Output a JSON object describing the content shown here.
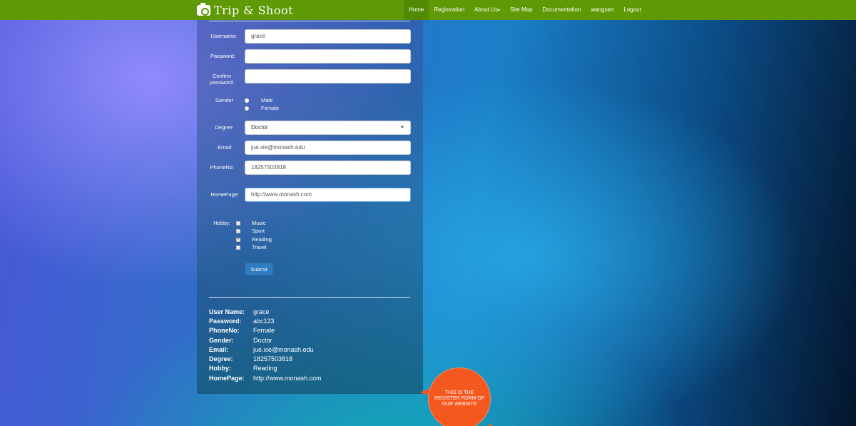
{
  "brand": {
    "name": "Trip & Shoot",
    "icon": "camera-icon"
  },
  "nav": {
    "items": [
      "Home",
      "Registration",
      "About Us",
      "Site Map",
      "Documentation",
      "wangsen",
      "Logout"
    ],
    "active": "Home"
  },
  "form": {
    "username_label": "Username:",
    "username_value": "grace",
    "password_label": "Password:",
    "confirm_label_1": "Confirm",
    "confirm_label_2": "password:",
    "gender_label": "Gender",
    "gender_options": [
      "Male",
      "Female"
    ],
    "gender_selected": "Male",
    "degree_label": "Degree",
    "degree_value": "Doctor",
    "email_label": "Email:",
    "email_value": "jue.xie@monash.edu",
    "phone_label": "PhoneNo:",
    "phone_value": "18257503818",
    "homepage_label": "HomePage:",
    "homepage_value": "http://www.monash.com",
    "hobby_label": "Hobby:",
    "hobby_options": [
      "Music",
      "Sport",
      "Reading",
      "Travel"
    ],
    "hobby_checked": [
      "Reading"
    ],
    "submit_label": "Submit"
  },
  "summary": {
    "rows": [
      {
        "key": "User Name:",
        "value": "grace"
      },
      {
        "key": "Password:",
        "value": "abc123"
      },
      {
        "key": "PhoneNo:",
        "value": "Female"
      },
      {
        "key": "Gender:",
        "value": "Doctor"
      },
      {
        "key": "Email:",
        "value": "jue.xie@monash.edu"
      },
      {
        "key": "Degree:",
        "value": "18257503818"
      },
      {
        "key": "Hobby:",
        "value": "Reading"
      },
      {
        "key": "HomePage:",
        "value": "http://www.monash.com"
      }
    ]
  },
  "bubble": {
    "text": "THIS IS THE REGISTER FORM OF OUR WEBSITE"
  },
  "colors": {
    "navbar": "#5f9a06",
    "bubble": "#f4581f",
    "button": "#2f7cc1"
  }
}
